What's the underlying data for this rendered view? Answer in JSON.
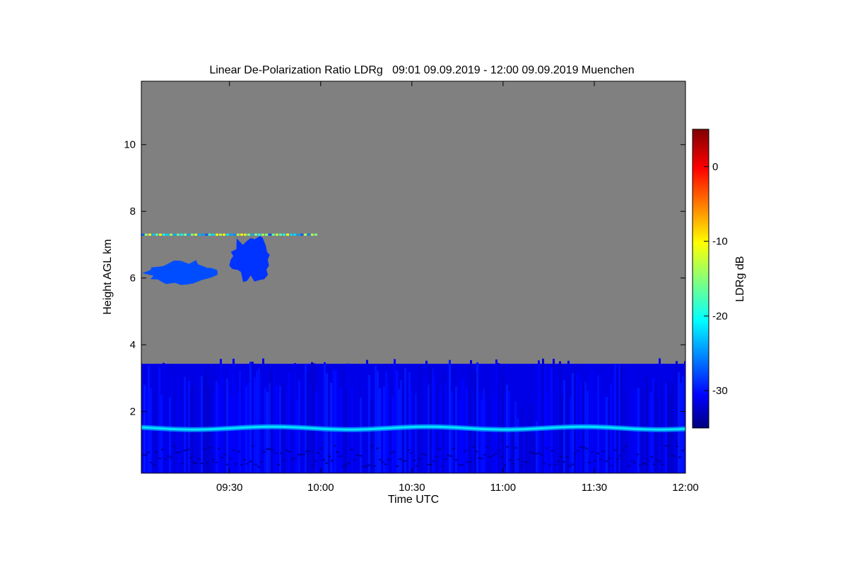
{
  "chart_data": {
    "type": "heatmap",
    "title": "Linear De-Polarization Ratio LDRg   09:01 09.09.2019 - 12:00 09.09.2019 Muenchen",
    "xlabel": "Time UTC",
    "ylabel": "Height AGL km",
    "colorbar_label": "LDRg dB",
    "x_range": [
      "09:01",
      "12:00"
    ],
    "x_ticks": [
      "09:30",
      "10:00",
      "10:30",
      "11:00",
      "11:30",
      "12:00"
    ],
    "y_range": [
      0.15,
      11.9
    ],
    "y_ticks": [
      2,
      4,
      6,
      8,
      10
    ],
    "colorbar_range": [
      -35,
      5
    ],
    "colorbar_ticks": [
      0,
      -10,
      -20,
      -30
    ],
    "colormap": "jet",
    "no_data_color": "#808080",
    "features": [
      {
        "name": "boundary-layer",
        "t_start": "09:01",
        "t_end": "12:00",
        "h_min": 0.15,
        "h_max": 3.6,
        "ldr_db": -31
      },
      {
        "name": "depolarization-layer",
        "t_start": "09:01",
        "t_end": "12:00",
        "h_center": 1.5,
        "ldr_db": -21
      },
      {
        "name": "mid-level-cloud-a",
        "t_start": "09:01",
        "t_end": "09:27",
        "h_min": 5.7,
        "h_max": 6.6,
        "ldr_db": -27
      },
      {
        "name": "mid-level-cloud-b",
        "t_start": "09:29",
        "t_end": "09:45",
        "h_min": 5.7,
        "h_max": 7.4,
        "ldr_db": -28
      },
      {
        "name": "artifact-line",
        "t_start": "09:01",
        "t_end": "09:58",
        "h_center": 7.3,
        "ldr_db": -18
      }
    ]
  }
}
